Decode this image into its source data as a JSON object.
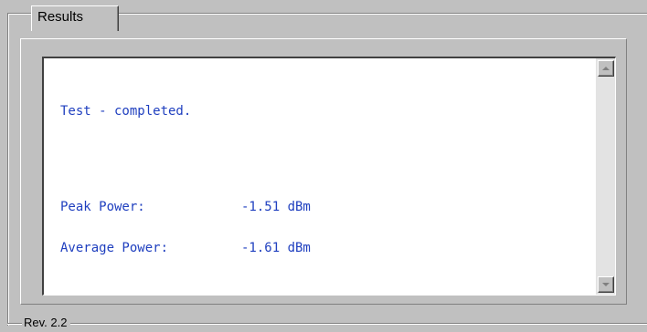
{
  "group": {
    "title": "Results",
    "footer": "Rev. 2.2"
  },
  "output": {
    "status_line": "Test - completed.",
    "measurements": [
      {
        "label": "Peak Power:",
        "value": "-1.51 dBm"
      },
      {
        "label": "Average Power:",
        "value": "-1.61 dBm"
      }
    ],
    "text_color": "#1f3fbf"
  },
  "scrollbar": {
    "up_icon": "scroll-up-arrow-icon",
    "down_icon": "scroll-down-arrow-icon"
  }
}
